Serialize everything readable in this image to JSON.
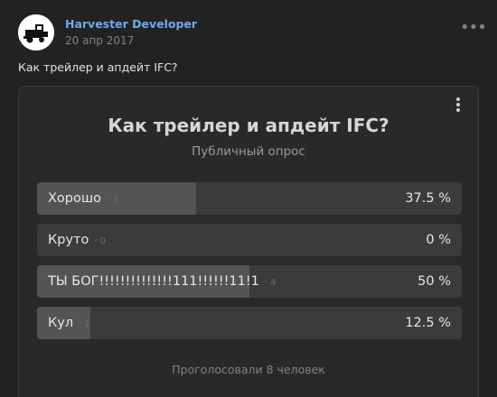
{
  "post": {
    "author": "Harvester Developer",
    "date": "20 апр 2017",
    "text": "Как трейлер и апдейт IFC?",
    "avatar_icon": "harvester-icon",
    "menu_icon": "more-horizontal-icon"
  },
  "poll": {
    "title": "Как трейлер и апдейт IFC?",
    "subtitle": "Публичный опрос",
    "menu_icon": "more-vertical-icon",
    "options": [
      {
        "label": "Хорошо",
        "count": "3",
        "percent": "37.5 %",
        "share": 0.375
      },
      {
        "label": "Круто",
        "count": "0",
        "percent": "0 %",
        "share": 0
      },
      {
        "label": "ТЫ БОГ!!!!!!!!!!!!!!111!!!!!!11!1",
        "count": "4",
        "percent": "50 %",
        "share": 0.5
      },
      {
        "label": "Кул",
        "count": "1",
        "percent": "12.5 %",
        "share": 0.125
      }
    ],
    "footer": "Проголосовали 8 человек"
  },
  "colors": {
    "background": "#222222",
    "card": "#292929",
    "author_link": "#71aaeb",
    "option_bar": "#3b3b3b",
    "option_fill": "#545454"
  }
}
